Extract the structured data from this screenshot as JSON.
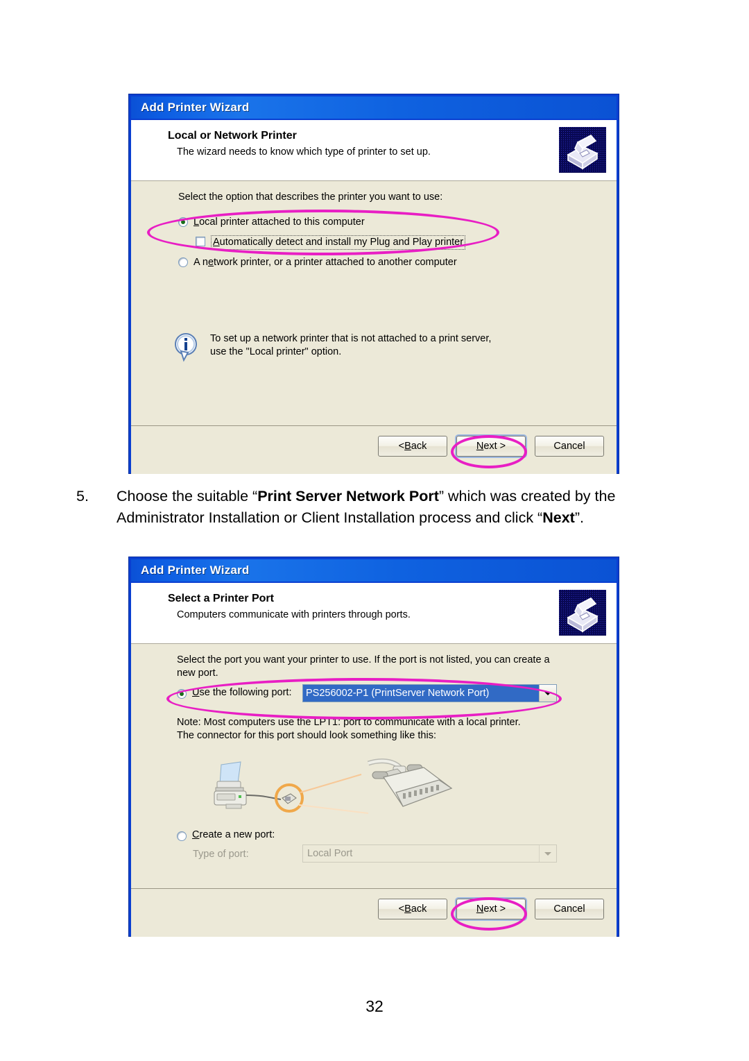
{
  "page": {
    "number": "32"
  },
  "caption": {
    "list_number": "5.",
    "part1": "Choose the suitable “",
    "bold1": "Print Server Network Port",
    "part2": "” which was created by the Administrator Installation or Client Installation process and click “",
    "bold2": "Next",
    "part3": "”."
  },
  "dialog1": {
    "title": "Add Printer Wizard",
    "header_title": "Local or Network Printer",
    "header_subtitle": "The wizard needs to know which type of printer to set up.",
    "header_icon": "printer-wizard-icon",
    "prompt": "Select the option that describes the printer you want to use:",
    "option_local": {
      "label": "Local printer attached to this computer",
      "accesskey": "L",
      "selected": true
    },
    "checkbox_autodetect": {
      "label": "Automatically detect and install my Plug and Play printer",
      "accesskey": "A",
      "checked": false
    },
    "option_network": {
      "label": "A network printer, or a printer attached to another computer",
      "accesskey": "e",
      "selected": false
    },
    "info": {
      "icon": "info-icon",
      "line1": "To set up a network printer that is not attached to a print server,",
      "line2": "use the \"Local printer\" option."
    },
    "buttons": {
      "back": "< Back",
      "back_accesskey": "B",
      "next": "Next >",
      "next_accesskey": "N",
      "cancel": "Cancel"
    },
    "highlights": [
      "option-local-group",
      "next-button"
    ]
  },
  "dialog2": {
    "title": "Add Printer Wizard",
    "header_title": "Select a Printer Port",
    "header_subtitle": "Computers communicate with printers through ports.",
    "header_icon": "printer-wizard-icon",
    "prompt_line1": "Select the port you want your printer to use.  If the port is not listed, you can create a",
    "prompt_line2": "new port.",
    "option_use_port": {
      "label": "Use the following port:",
      "accesskey": "U",
      "selected": true
    },
    "port_combo": {
      "value": "PS256002-P1 (PrintServer Network Port)",
      "arrow_icon": "chevron-down-icon"
    },
    "note_line1": "Note: Most computers use the LPT1: port to communicate with a local printer.",
    "note_line2": "The connector for this port should look something like this:",
    "illustration": "printer-parallel-connector-illustration",
    "option_create_port": {
      "label": "Create a new port:",
      "accesskey": "C",
      "selected": false
    },
    "type_of_port_label": "Type of port:",
    "type_combo": {
      "value": "Local Port",
      "arrow_icon": "chevron-down-icon",
      "disabled": true
    },
    "buttons": {
      "back": "< Back",
      "back_accesskey": "B",
      "next": "Next >",
      "next_accesskey": "N",
      "cancel": "Cancel"
    },
    "highlights": [
      "use-following-port-row",
      "next-button"
    ]
  },
  "colors": {
    "title_blue": "#0d5de2",
    "dialog_border": "#0a3fd1",
    "face": "#ece9d8",
    "highlight_magenta": "#e81ec4",
    "selection_blue": "#316ac5"
  }
}
